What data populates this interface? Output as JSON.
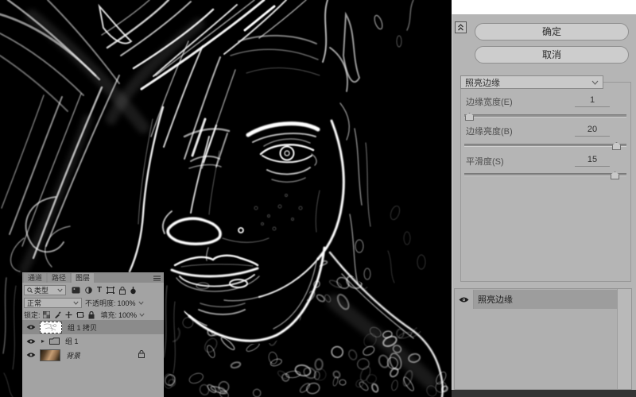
{
  "filter_panel": {
    "ok_label": "确定",
    "cancel_label": "取消",
    "filter_select": {
      "value": "照亮边缘"
    },
    "sliders": [
      {
        "label": "边缘宽度(E)",
        "value": "1"
      },
      {
        "label": "边缘亮度(B)",
        "value": "20"
      },
      {
        "label": "平滑度(S)",
        "value": "15"
      }
    ],
    "effects_list": [
      {
        "name": "照亮边缘",
        "visible": true,
        "selected": true
      }
    ]
  },
  "layers_panel": {
    "tabs": [
      {
        "label": "通道"
      },
      {
        "label": "路径"
      },
      {
        "label": "图层",
        "active": true
      }
    ],
    "kind": {
      "value": "类型"
    },
    "blend_mode": {
      "value": "正常"
    },
    "opacity": {
      "label": "不透明度:",
      "value": "100%"
    },
    "lock_label": "锁定:",
    "fill": {
      "label": "填充:",
      "value": "100%"
    },
    "layers": [
      {
        "name": "组 1 拷贝",
        "selected": true,
        "visible": true
      },
      {
        "name": "组 1",
        "type": "group",
        "visible": true
      },
      {
        "name": "背景",
        "visible": true,
        "locked": true
      }
    ]
  }
}
